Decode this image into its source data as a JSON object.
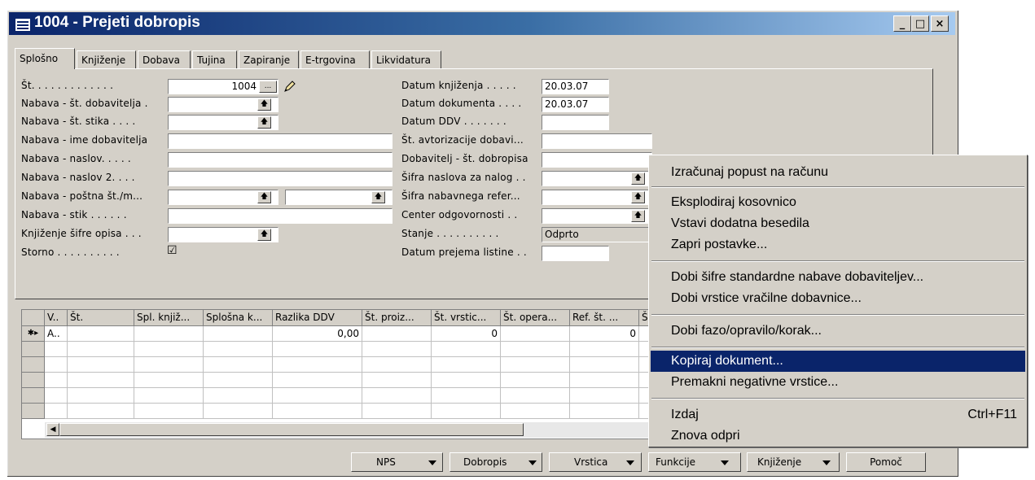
{
  "window": {
    "title": "1004 - Prejeti dobropis",
    "minimize": "_",
    "maximize": "□",
    "close": "×"
  },
  "tabs": [
    "Splošno",
    "Knjiženje",
    "Dobava",
    "Tujina",
    "Zapiranje",
    "E-trgovina",
    "Likvidatura"
  ],
  "left_fields": [
    {
      "label": "Št. . . . . . . . . . . . .",
      "value": "1004"
    },
    {
      "label": "Nabava - št. dobavitelja .",
      "value": ""
    },
    {
      "label": "Nabava - št. stika . . . .",
      "value": ""
    },
    {
      "label": "Nabava - ime dobavitelja",
      "value": ""
    },
    {
      "label": "Nabava - naslov. . . . .",
      "value": ""
    },
    {
      "label": "Nabava - naslov 2. . . .",
      "value": ""
    },
    {
      "label": "Nabava - poštna št./m...",
      "value": ""
    },
    {
      "label": "Nabava - stik . . . . . .",
      "value": ""
    },
    {
      "label": "Knjiženje šifre opisa . . .",
      "value": ""
    },
    {
      "label": "Storno . . . . . . . . . .",
      "value": "☑"
    }
  ],
  "assist_button": "...",
  "right_fields": [
    {
      "label": "Datum knjiženja . . . . .",
      "value": "20.03.07"
    },
    {
      "label": "Datum dokumenta . . . .",
      "value": "20.03.07"
    },
    {
      "label": "Datum DDV . . . . . . .",
      "value": ""
    },
    {
      "label": "Št. avtorizacije dobavi...",
      "value": ""
    },
    {
      "label": "Dobavitelj - št. dobropisa",
      "value": ""
    },
    {
      "label": "Šifra naslova za nalog . .",
      "value": ""
    },
    {
      "label": "Šifra nabavnega refer...",
      "value": ""
    },
    {
      "label": "Center odgovornosti . .",
      "value": ""
    },
    {
      "label": "Stanje . . . . . . . . . .",
      "value": "Odprto"
    },
    {
      "label": "Datum prejema listine . .",
      "value": ""
    }
  ],
  "grid": {
    "headers": [
      "V..",
      "Št.",
      "Spl. knjiž...",
      "Splošna k...",
      "Razlika DDV",
      "Št. proiz...",
      "Št. vrstic...",
      "Št. opera...",
      "Ref. št. ...",
      "Š"
    ],
    "new_row_marker": "✱▸",
    "row": [
      "A..",
      "",
      "",
      "",
      "0,00",
      "",
      "0",
      "",
      "0",
      ""
    ]
  },
  "buttons": [
    {
      "label": "NPS"
    },
    {
      "label": "Dobropis"
    },
    {
      "label": "Vrstica"
    },
    {
      "label": "Funkcije"
    },
    {
      "label": "Knjiženje"
    },
    {
      "label": "Pomoč"
    }
  ],
  "menu": {
    "items": [
      {
        "label": "Izračunaj popust na računu",
        "shortcut": ""
      },
      {
        "label": "Eksplodiraj kosovnico",
        "shortcut": ""
      },
      {
        "label": "Vstavi dodatna besedila",
        "shortcut": ""
      },
      {
        "label": "Zapri postavke...",
        "shortcut": ""
      },
      {
        "label": "Dobi šifre standardne nabave dobaviteljev...",
        "shortcut": ""
      },
      {
        "label": "Dobi vrstice vračilne dobavnice...",
        "shortcut": ""
      },
      {
        "label": "Dobi fazo/opravilo/korak...",
        "shortcut": ""
      },
      {
        "label": "Kopiraj dokument...",
        "shortcut": ""
      },
      {
        "label": "Premakni negativne vrstice...",
        "shortcut": ""
      },
      {
        "label": "Izdaj",
        "shortcut": "Ctrl+F11"
      },
      {
        "label": "Znova odpri",
        "shortcut": ""
      }
    ],
    "highlighted_index": 7
  },
  "colors": {
    "titlebar": "#0a246a",
    "face": "#d4d0c8",
    "highlight": "#0a246a"
  }
}
